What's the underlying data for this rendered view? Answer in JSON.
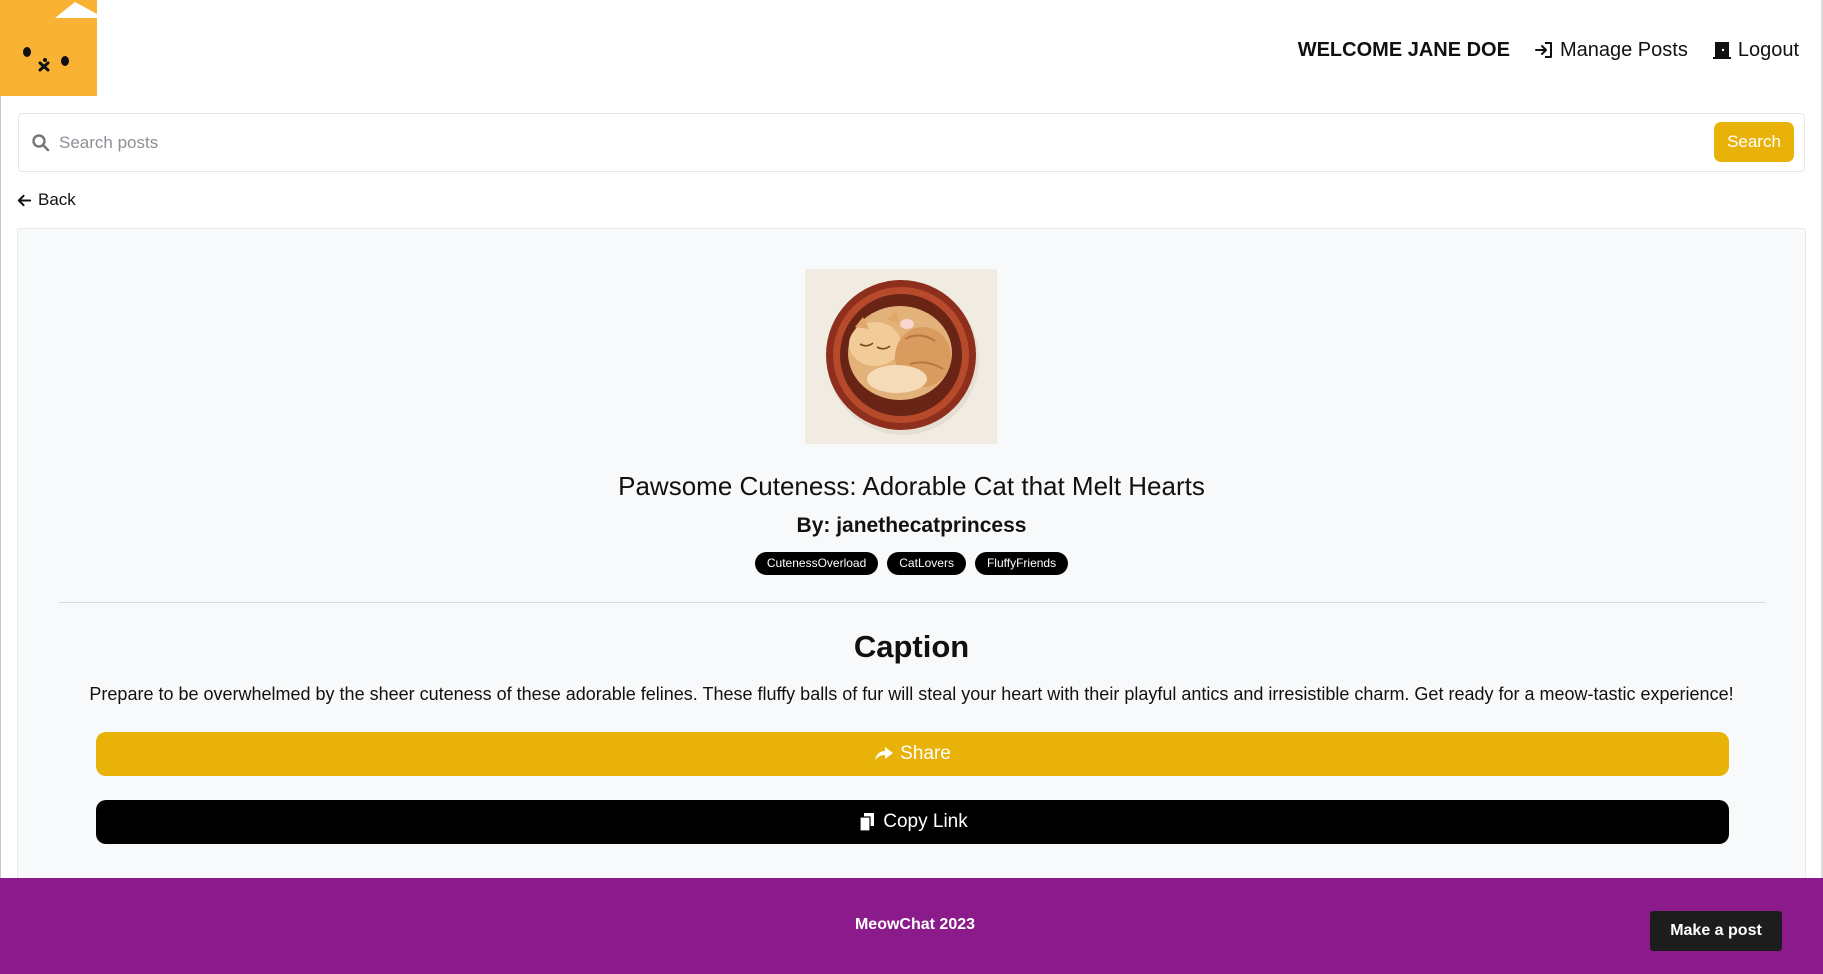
{
  "header": {
    "welcome": "WELCOME JANE DOE",
    "manage_posts": "Manage Posts",
    "logout": "Logout"
  },
  "search": {
    "placeholder": "Search posts",
    "value": "",
    "button_label": "Search"
  },
  "nav": {
    "back_label": "Back"
  },
  "post": {
    "title": "Pawsome Cuteness: Adorable Cat that Melt Hearts",
    "author": "By: janethecatprincess",
    "tags": [
      "CutenessOverload",
      "CatLovers",
      "FluffyFriends"
    ],
    "caption_heading": "Caption",
    "caption_text": "Prepare to be overwhelmed by the sheer cuteness of these adorable felines. These fluffy balls of fur will steal your heart with their playful antics and irresistible charm. Get ready for a meow-tastic experience!",
    "share_label": "Share",
    "copy_label": "Copy Link"
  },
  "footer": {
    "text": "MeowChat 2023",
    "make_post_label": "Make a post"
  },
  "colors": {
    "accent_yellow": "#e9b209",
    "logo_orange": "#f9b233",
    "footer_purple": "#8b1a8b",
    "tag_black": "#000000"
  },
  "icons": {
    "logo": "cat-face-icon",
    "manage_posts": "sign-in-arrow-icon",
    "logout": "door-icon",
    "search": "magnifier-icon",
    "back": "arrow-left-icon",
    "share": "share-arrow-icon",
    "copy": "copy-icon"
  }
}
